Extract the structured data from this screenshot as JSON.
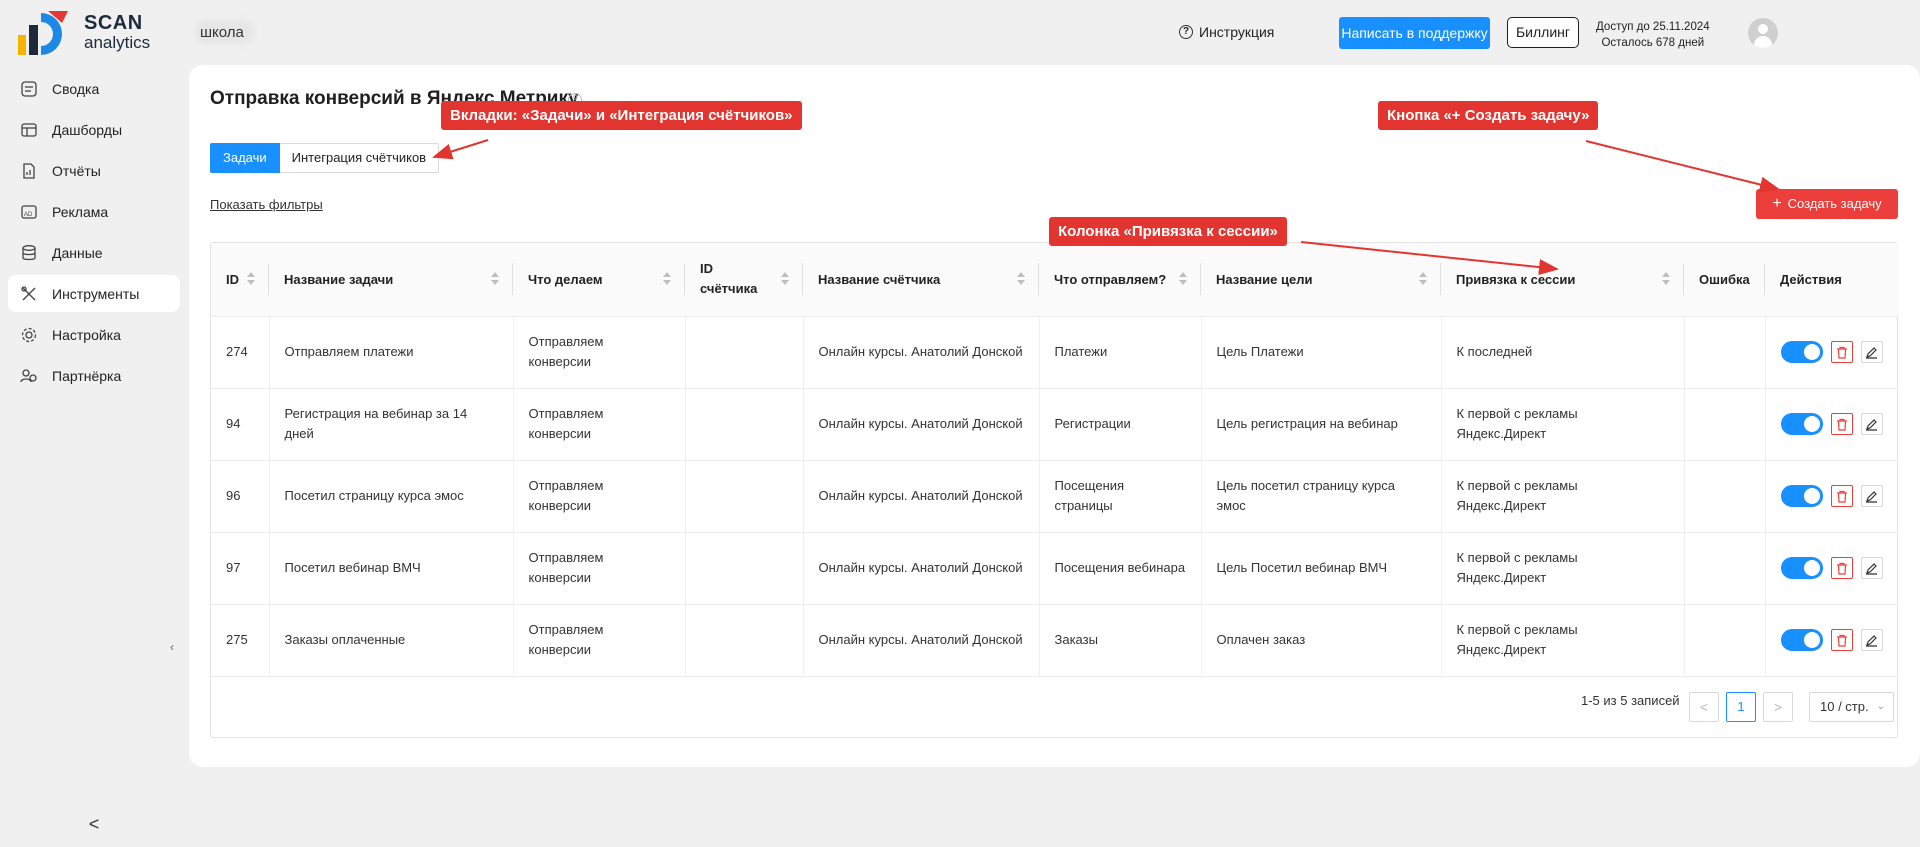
{
  "brand": {
    "name_top": "SCAN",
    "name_bottom": "analytics"
  },
  "header": {
    "project": "школа",
    "instruction": "Инструкция",
    "support_button": "Написать в поддержку",
    "billing_button": "Биллинг",
    "access_line1": "Доступ до 25.11.2024",
    "access_line2": "Осталось 678 дней"
  },
  "sidebar": {
    "items": [
      {
        "label": "Сводка",
        "icon": "summary-icon"
      },
      {
        "label": "Дашборды",
        "icon": "dashboard-icon"
      },
      {
        "label": "Отчёты",
        "icon": "reports-icon"
      },
      {
        "label": "Реклама",
        "icon": "ads-icon"
      },
      {
        "label": "Данные",
        "icon": "database-icon"
      },
      {
        "label": "Инструменты",
        "icon": "tools-icon"
      },
      {
        "label": "Настройка",
        "icon": "settings-icon"
      },
      {
        "label": "Партнёрка",
        "icon": "partner-icon"
      }
    ],
    "active_index": 5,
    "collapse_mini": "‹",
    "collapse_bottom": "<"
  },
  "page": {
    "title": "Отправка конверсий в Яндекс Метрику",
    "tabs": [
      "Задачи",
      "Интеграция счётчиков"
    ],
    "show_filters": "Показать фильтры",
    "create_button": "Создать задачу"
  },
  "table": {
    "columns": [
      "ID",
      "Название задачи",
      "Что делаем",
      "ID счётчика",
      "Название счётчика",
      "Что отправляем?",
      "Название цели",
      "Привязка к сессии",
      "Ошибка",
      "Действия"
    ],
    "rows": [
      {
        "id": "274",
        "task": "Отправляем платежи",
        "action": "Отправляем конверсии",
        "counter_id": "",
        "counter": "Онлайн курсы. Анатолий Донской",
        "sending": "Платежи",
        "goal": "Цель Платежи",
        "binding": "К последней",
        "error": ""
      },
      {
        "id": "94",
        "task": "Регистрация на вебинар за 14 дней",
        "action": "Отправляем конверсии",
        "counter_id": "",
        "counter": "Онлайн курсы. Анатолий Донской",
        "sending": "Регистрации",
        "goal": "Цель регистрация на вебинар",
        "binding": "К первой с рекламы Яндекс.Директ",
        "error": ""
      },
      {
        "id": "96",
        "task": "Посетил страницу курса эмос",
        "action": "Отправляем конверсии",
        "counter_id": "",
        "counter": "Онлайн курсы. Анатолий Донской",
        "sending": "Посещения страницы",
        "goal": "Цель посетил страницу курса эмос",
        "binding": "К первой с рекламы Яндекс.Директ",
        "error": ""
      },
      {
        "id": "97",
        "task": "Посетил вебинар ВМЧ",
        "action": "Отправляем конверсии",
        "counter_id": "",
        "counter": "Онлайн курсы. Анатолий Донской",
        "sending": "Посещения вебинара",
        "goal": "Цель Посетил вебинар ВМЧ",
        "binding": "К первой с рекламы Яндекс.Директ",
        "error": ""
      },
      {
        "id": "275",
        "task": "Заказы оплаченные",
        "action": "Отправляем конверсии",
        "counter_id": "",
        "counter": "Онлайн курсы. Анатолий Донской",
        "sending": "Заказы",
        "goal": "Оплачен заказ",
        "binding": "К первой с рекламы Яндекс.Директ",
        "error": ""
      }
    ]
  },
  "pagination": {
    "summary": "1-5 из 5 записей",
    "prev": "<",
    "current": "1",
    "next": ">",
    "page_size": "10 / стр."
  },
  "annotations": {
    "tabs": "Вкладки: «Задачи» и «Интеграция счётчиков»",
    "create": "Кнопка «+ Создать задачу»",
    "column": "Колонка «Привязка к сессии»"
  },
  "colors": {
    "accent": "#1890ff",
    "danger": "#ec3e3a",
    "annotation": "#e33530"
  }
}
